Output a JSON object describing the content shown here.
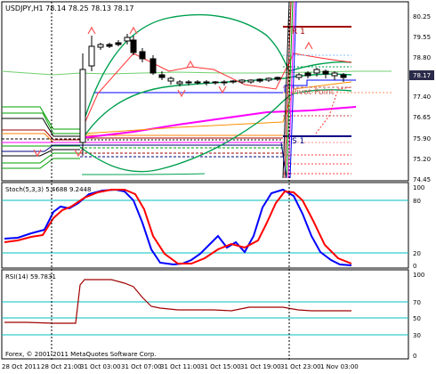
{
  "main": {
    "title": "USDJPY,H1  78.14 78.25 78.13 78.17",
    "price_ticks": [
      "80.25",
      "79.55",
      "78.80",
      "78.17",
      "77.40",
      "76.65",
      "75.90",
      "75.20",
      "74.45"
    ],
    "current_price": "78.17",
    "pivot_labels": {
      "r1": "R 1",
      "pivot": "Pivot Point",
      "s1": "S 1"
    }
  },
  "stoch": {
    "title": "Stoch(5,3,3) 5.4688 9.2448",
    "levels": [
      "100",
      "80",
      "20",
      "0"
    ]
  },
  "rsi": {
    "title": "RSI(14) 59.7831",
    "levels": [
      "100",
      "70",
      "50",
      "30",
      "0"
    ]
  },
  "copyright": "Forex, © 2001-2011 MetaQuotes Software Corp.",
  "time_axis": [
    "28 Oct 2011",
    "28 Oct 21:00",
    "31 Oct 03:00",
    "31 Oct 07:00",
    "31 Oct 11:00",
    "31 Oct 15:00",
    "31 Oct 19:00",
    "31 Oct 23:00",
    "1 Nov 03:00"
  ],
  "colors": {
    "background": "#ffffff",
    "border": "#000000",
    "stoch_main": "#0000ff",
    "stoch_signal": "#ff0000",
    "rsi_line": "#a00000",
    "level_line": "#00c0c0",
    "bollinger": "#00a050",
    "ma_magenta": "#ff00ff",
    "pivot_dark_red": "#a00000",
    "support_navy": "#000080",
    "current_price_box": "#2a2a4a"
  }
}
